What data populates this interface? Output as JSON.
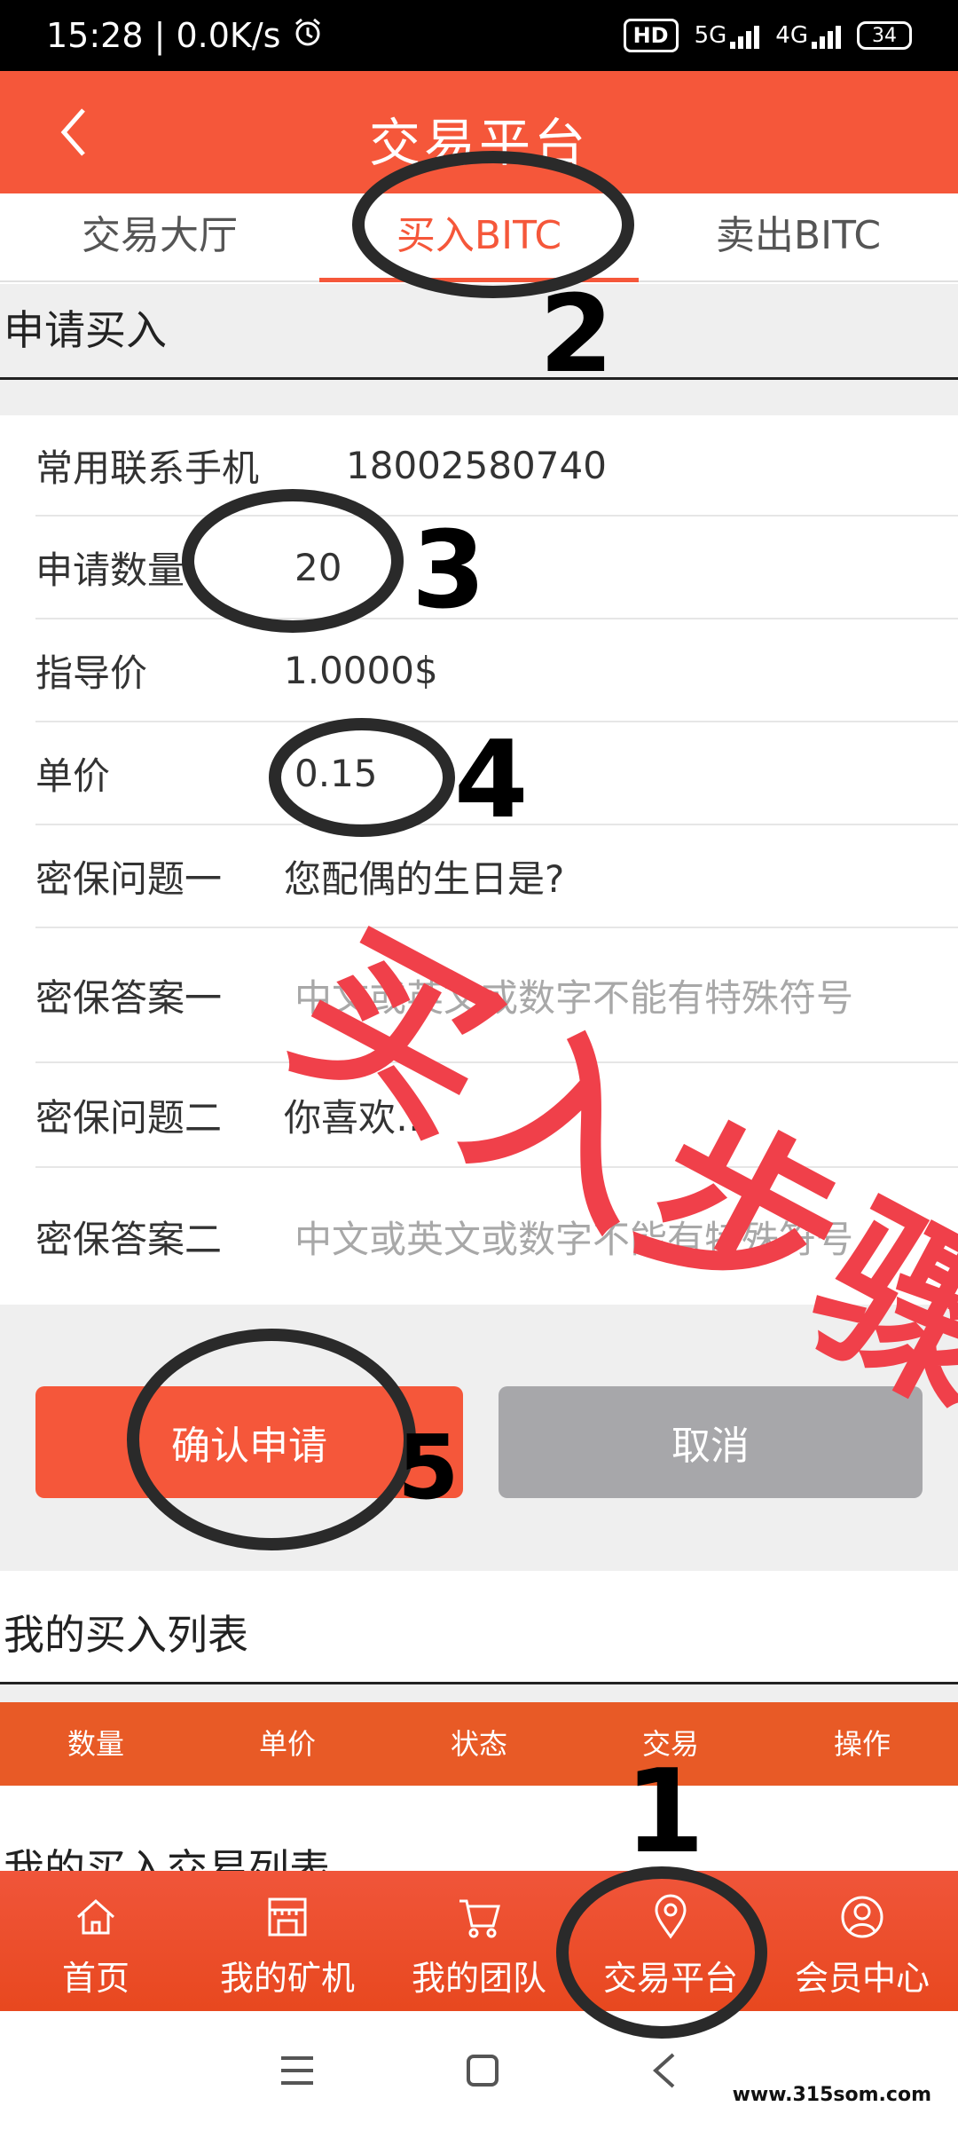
{
  "status_bar": {
    "time": "15:28 | 0.0K/s",
    "hd": "HD",
    "net1": "5G",
    "net2": "4G",
    "battery": "34"
  },
  "header": {
    "title": "交易平台"
  },
  "tabs": [
    {
      "label": "交易大厅",
      "active": false
    },
    {
      "label": "买入BITC",
      "active": true
    },
    {
      "label": "卖出BITC",
      "active": false
    }
  ],
  "section_apply": "申请买入",
  "form": {
    "phone_label": "常用联系手机",
    "phone_value": "18002580740",
    "qty_label": "申请数量",
    "qty_value": "20",
    "guide_label": "指导价",
    "guide_value": "1.0000$",
    "price_label": "单价",
    "price_value": "0.15",
    "q1_label": "密保问题一",
    "q1_value": "您配偶的生日是?",
    "a1_label": "密保答案一",
    "a1_placeholder": "中文或英文或数字不能有特殊符号",
    "q2_label": "密保问题二",
    "q2_value": "你喜欢…",
    "a2_label": "密保答案二",
    "a2_placeholder": "中文或英文或数字不能有特殊符号"
  },
  "buttons": {
    "confirm": "确认申请",
    "cancel": "取消"
  },
  "section_buy_list": "我的买入列表",
  "list_columns": [
    "数量",
    "单价",
    "状态",
    "交易",
    "操作"
  ],
  "section_buy_trade_list": "我的买入交易列表",
  "bottom_nav": [
    {
      "label": "首页",
      "icon": "home-icon"
    },
    {
      "label": "我的矿机",
      "icon": "shop-icon"
    },
    {
      "label": "我的团队",
      "icon": "cart-icon"
    },
    {
      "label": "交易平台",
      "icon": "location-pin-icon"
    },
    {
      "label": "会员中心",
      "icon": "user-icon"
    }
  ],
  "overlay": {
    "stamp": "买入步骤",
    "steps": [
      "1",
      "2",
      "3",
      "4",
      "5"
    ]
  },
  "watermark": "www.315som.com",
  "colors": {
    "accent": "#f5573a",
    "list_header": "#e85a26",
    "cancel": "#a7a7aa",
    "stamp": "#f0404a"
  }
}
